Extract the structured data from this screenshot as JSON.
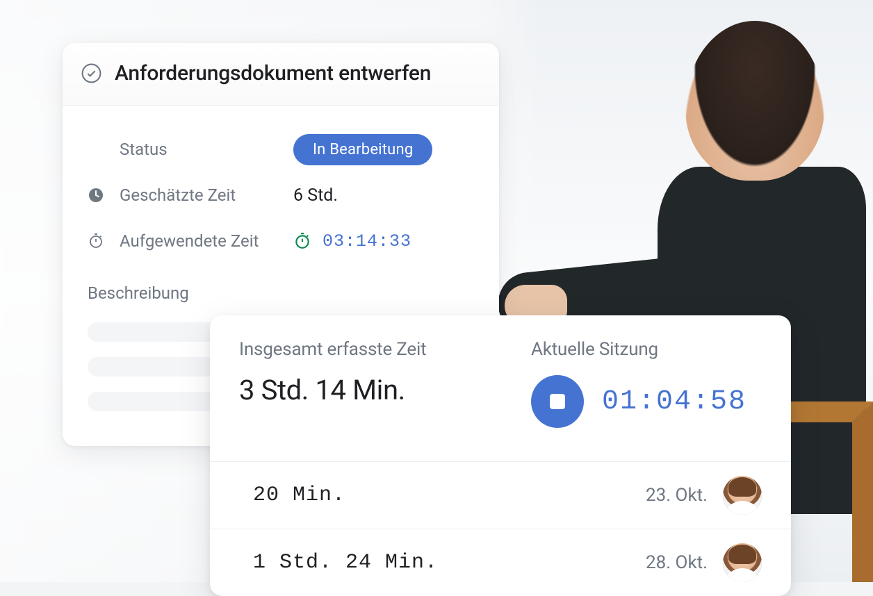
{
  "task": {
    "title": "Anforderungsdokument entwerfen",
    "fields": {
      "status_label": "Status",
      "status_value": "In Bearbeitung",
      "estimated_label": "Geschätzte Zeit",
      "estimated_value": "6 Std.",
      "spent_label": "Aufgewendete Zeit",
      "spent_value": "03:14:33"
    },
    "description_label": "Beschreibung"
  },
  "timelog": {
    "total_label": "Insgesamt erfasste Zeit",
    "total_value": "3 Std. 14 Min.",
    "session_label": "Aktuelle Sitzung",
    "session_value": "01:04:58",
    "entries": [
      {
        "duration": "20 Min.",
        "date": "23. Okt."
      },
      {
        "duration": "1 Std. 24 Min.",
        "date": "28. Okt."
      }
    ]
  },
  "colors": {
    "accent": "#4573d2",
    "success": "#0b8a4f",
    "muted": "#6f7782"
  }
}
